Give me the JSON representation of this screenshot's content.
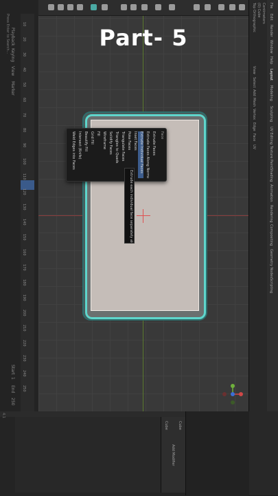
{
  "title_overlay": "Part- 5",
  "timeline": {
    "labels": [
      "Playback",
      "Keying",
      "View",
      "Marker"
    ],
    "frames": [
      "10",
      "20",
      "30",
      "40",
      "50",
      "60",
      "70",
      "80",
      "90",
      "100",
      "110",
      "120",
      "130",
      "140",
      "150",
      "160",
      "170",
      "180",
      "190",
      "200",
      "210",
      "220",
      "230",
      "240",
      "250"
    ],
    "current_frame": "120",
    "start_label": "Start",
    "start_value": "1",
    "end_label": "End",
    "end_value": "250"
  },
  "status": {
    "left_hint": "Press Enter to Search...",
    "version": "4.1"
  },
  "context_menu": {
    "title": "Face",
    "items": [
      "Extrude Faces",
      "Extrude Faces Along Normals",
      "Extrude Individual Faces",
      "Inset Faces",
      "Poke Faces",
      "Triangulate Faces",
      "Triangles to Quads",
      "Solidify Faces",
      "Wireframe",
      "Fill",
      "Grid Fill",
      "Beautify Fill",
      "Intersect (Knife)",
      "Weld Edges into Faces"
    ],
    "highlighted_index": 2,
    "tooltip": "Extrude each individual face separately along local normals."
  },
  "right_panel": {
    "tabs": [
      "Layout",
      "Modeling",
      "Sculpting",
      "UV Editing",
      "Texture Paint",
      "Shading",
      "Animation",
      "Rendering",
      "Compositing",
      "Geometry Nodes",
      "Scripting"
    ],
    "header_items": [
      "File",
      "Edit",
      "Render",
      "Window",
      "Help"
    ],
    "view_items": [
      "View",
      "Select",
      "Add",
      "Mesh",
      "Vertex",
      "Edge",
      "Face",
      "UV"
    ],
    "viewport_info": [
      "Top Orthographic",
      "(0) Cube",
      "Centimeters"
    ]
  },
  "properties": {
    "object": "Cube",
    "modifier": "Add Modifier",
    "mesh_label": "Cube"
  },
  "colors": {
    "mesh_edge_highlight": "#5fd6cc",
    "menu_highlight": "#3d5d8d",
    "axis_x": "#8a3c3c",
    "axis_y": "#5b7a2d"
  },
  "icons": [
    "select-box-icon",
    "move-icon",
    "rotate-icon",
    "scale-icon",
    "overlay-icon",
    "shading-solid-icon",
    "gizmo-axis-icon"
  ]
}
